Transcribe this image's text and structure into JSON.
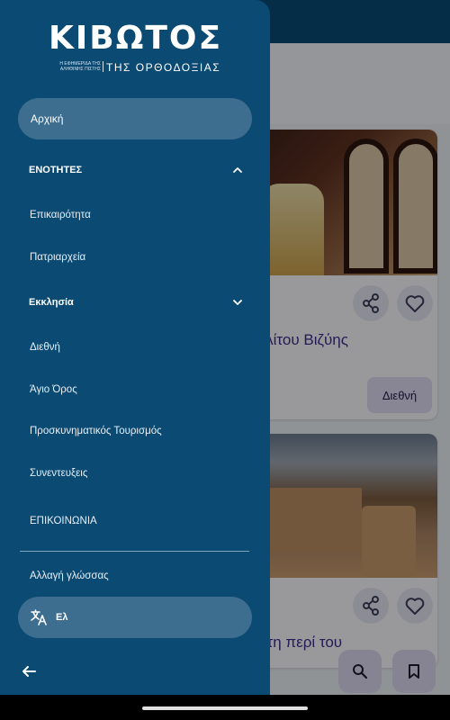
{
  "drawer": {
    "logo": {
      "title": "ΚΙΒΩΤΟΣ",
      "tagline": "Η ΕΦΗΜΕΡΙΔΑ ΤΗΣ ΑΛΗΘΙΝΗΣ ΠΙΣΤΗΣ",
      "subtitle": "ΤΗΣ ΟΡΘΟΔΟΞΙΑΣ"
    },
    "home_label": "Αρχική",
    "sections": [
      {
        "label": "ΕΝΟΤΗΤΕΣ",
        "expanded": true,
        "items": [
          "Επικαιρότητα",
          "Πατριαρχεία"
        ]
      },
      {
        "label": "Εκκλησία",
        "expanded": true,
        "items": [
          "Διεθνή",
          "Άγιο Όρος",
          "Προσκυνηματικός Τουρισμός",
          "Συνεντευξεις"
        ]
      }
    ],
    "contact_label": "ΕΠΙΚΟΙΝΩΝΙΑ",
    "change_language_label": "Αλλαγή γλώσσας",
    "language_value": "Ελ",
    "language_icon": "translate-icon",
    "back_icon": "arrow-back-icon"
  },
  "background": {
    "card1": {
      "title_partial": "ολίτου Βιζύης",
      "chip": "Διεθνή"
    },
    "card2": {
      "title_partial": "στη περί του"
    },
    "fab_icons": [
      "search-icon",
      "bookmark-icon"
    ]
  },
  "colors": {
    "drawer_bg": "#0b4a73",
    "pill_bg": "#3d6d8f",
    "accent_text": "#3b2e8c"
  }
}
